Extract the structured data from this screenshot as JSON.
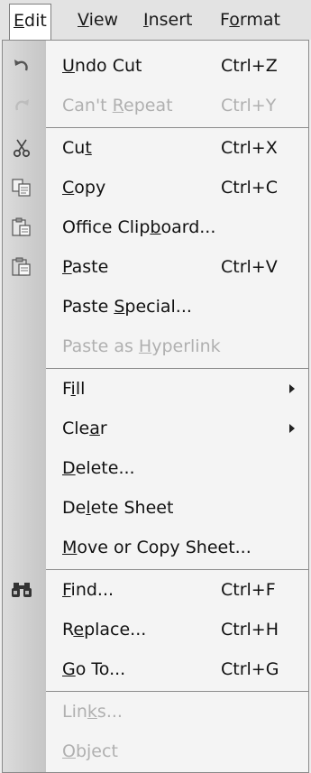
{
  "menubar": {
    "items": [
      {
        "label": "Edit",
        "pre": "",
        "acc": "E",
        "post": "dit",
        "active": true
      },
      {
        "label": "View",
        "pre": "",
        "acc": "V",
        "post": "iew",
        "active": false
      },
      {
        "label": "Insert",
        "pre": "",
        "acc": "I",
        "post": "nsert",
        "active": false
      },
      {
        "label": "Format",
        "pre": "F",
        "acc": "o",
        "post": "rmat",
        "active": false
      }
    ]
  },
  "menu": {
    "items": [
      {
        "pre": "",
        "acc": "U",
        "post": "ndo Cut",
        "shortcut": "Ctrl+Z",
        "icon": "undo-icon",
        "disabled": false,
        "submenu": false
      },
      {
        "pre": "Can't ",
        "acc": "R",
        "post": "epeat",
        "shortcut": "Ctrl+Y",
        "icon": "repeat-icon",
        "disabled": true,
        "submenu": false
      },
      {
        "pre": "Cu",
        "acc": "t",
        "post": "",
        "shortcut": "Ctrl+X",
        "icon": "scissors-icon",
        "disabled": false,
        "submenu": false
      },
      {
        "pre": "",
        "acc": "C",
        "post": "opy",
        "shortcut": "Ctrl+C",
        "icon": "copy-icon",
        "disabled": false,
        "submenu": false
      },
      {
        "pre": "Office Clip",
        "acc": "b",
        "post": "oard...",
        "shortcut": "",
        "icon": "clipboard-icon",
        "disabled": false,
        "submenu": false
      },
      {
        "pre": "",
        "acc": "P",
        "post": "aste",
        "shortcut": "Ctrl+V",
        "icon": "paste-icon",
        "disabled": false,
        "submenu": false
      },
      {
        "pre": "Paste ",
        "acc": "S",
        "post": "pecial...",
        "shortcut": "",
        "icon": "",
        "disabled": false,
        "submenu": false
      },
      {
        "pre": "Paste as ",
        "acc": "H",
        "post": "yperlink",
        "shortcut": "",
        "icon": "",
        "disabled": true,
        "submenu": false
      },
      {
        "pre": "F",
        "acc": "i",
        "post": "ll",
        "shortcut": "",
        "icon": "",
        "disabled": false,
        "submenu": true
      },
      {
        "pre": "Cle",
        "acc": "a",
        "post": "r",
        "shortcut": "",
        "icon": "",
        "disabled": false,
        "submenu": true
      },
      {
        "pre": "",
        "acc": "D",
        "post": "elete...",
        "shortcut": "",
        "icon": "",
        "disabled": false,
        "submenu": false
      },
      {
        "pre": "De",
        "acc": "l",
        "post": "ete Sheet",
        "shortcut": "",
        "icon": "",
        "disabled": false,
        "submenu": false
      },
      {
        "pre": "",
        "acc": "M",
        "post": "ove or Copy Sheet...",
        "shortcut": "",
        "icon": "",
        "disabled": false,
        "submenu": false
      },
      {
        "pre": "",
        "acc": "F",
        "post": "ind...",
        "shortcut": "Ctrl+F",
        "icon": "binoculars-icon",
        "disabled": false,
        "submenu": false
      },
      {
        "pre": "R",
        "acc": "e",
        "post": "place...",
        "shortcut": "Ctrl+H",
        "icon": "",
        "disabled": false,
        "submenu": false
      },
      {
        "pre": "",
        "acc": "G",
        "post": "o To...",
        "shortcut": "Ctrl+G",
        "icon": "",
        "disabled": false,
        "submenu": false
      },
      {
        "pre": "Lin",
        "acc": "k",
        "post": "s...",
        "shortcut": "",
        "icon": "",
        "disabled": true,
        "submenu": false
      },
      {
        "pre": "",
        "acc": "O",
        "post": "bject",
        "shortcut": "",
        "icon": "",
        "disabled": true,
        "submenu": false
      }
    ]
  }
}
